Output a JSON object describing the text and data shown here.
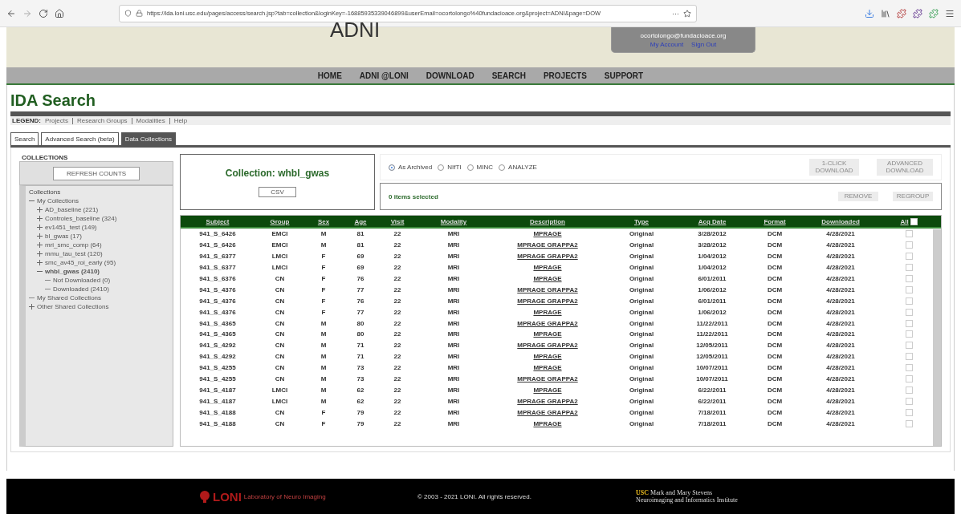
{
  "browser": {
    "url": "https://ida.loni.usc.edu/pages/access/search.jsp?tab=collection&loginKey=-16885935339046899&userEmail=ocortolongo%40fundacioace.org&project=ADNI&page=DOW",
    "more": "···"
  },
  "header": {
    "logo": "ADNI",
    "email": "ocortolongo@fundacioace.org",
    "links": [
      "My Account",
      "Sign Out"
    ]
  },
  "nav": [
    "HOME",
    "ADNI @LONI",
    "DOWNLOAD",
    "SEARCH",
    "PROJECTS",
    "SUPPORT"
  ],
  "page_title": "IDA Search",
  "legend": {
    "label": "LEGEND:",
    "links": [
      "Projects",
      "Research Groups",
      "Modalities",
      "Help"
    ]
  },
  "tabs": [
    {
      "label": "Search",
      "selected": false
    },
    {
      "label": "Advanced Search (beta)",
      "selected": false
    },
    {
      "label": "Data Collections",
      "selected": true
    }
  ],
  "collections": {
    "title": "COLLECTIONS",
    "refresh": "REFRESH COUNTS",
    "root": "Collections",
    "tree": [
      {
        "label": "My Collections",
        "expanded": true,
        "selected": false,
        "children": [
          {
            "label": "AD_baseline (221)",
            "expanded": false,
            "selected": false
          },
          {
            "label": "Controles_baseline (324)",
            "expanded": false,
            "selected": false
          },
          {
            "label": "ev1451_test (149)",
            "expanded": false,
            "selected": false
          },
          {
            "label": "bl_gwas (17)",
            "expanded": false,
            "selected": false
          },
          {
            "label": "mri_smc_comp (64)",
            "expanded": false,
            "selected": false
          },
          {
            "label": "mmu_tau_test (120)",
            "expanded": false,
            "selected": false
          },
          {
            "label": "smc_av45_roi_early (95)",
            "expanded": false,
            "selected": false
          },
          {
            "label": "whbl_gwas (2410)",
            "expanded": true,
            "selected": true,
            "children": [
              {
                "label": "Not Downloaded (0)",
                "selected": false
              },
              {
                "label": "Downloaded (2410)",
                "selected": false
              }
            ]
          }
        ]
      },
      {
        "label": "My Shared Collections",
        "selected": false
      },
      {
        "label": "Other Shared Collections",
        "expanded": false,
        "selected": false
      }
    ]
  },
  "collection": {
    "title": "Collection: whbl_gwas",
    "csv": "CSV"
  },
  "formats": [
    {
      "label": "As Archived",
      "selected": true
    },
    {
      "label": "NIfTI",
      "selected": false
    },
    {
      "label": "MINC",
      "selected": false
    },
    {
      "label": "ANALYZE",
      "selected": false
    }
  ],
  "download_buttons": [
    {
      "label": "1-CLICK DOWNLOAD",
      "disabled": true
    },
    {
      "label": "ADVANCED DOWNLOAD",
      "disabled": true
    }
  ],
  "selection": {
    "text": "0 items selected",
    "buttons": [
      {
        "label": "REMOVE",
        "disabled": true
      },
      {
        "label": "REGROUP",
        "disabled": true
      }
    ]
  },
  "table": {
    "columns": [
      "Subject",
      "Group",
      "Sex",
      "Age",
      "Visit",
      "Modality",
      "Description",
      "Type",
      "Acq Date",
      "Format",
      "Downloaded",
      "All"
    ],
    "all_checked": false,
    "rows": [
      [
        "941_S_6426",
        "EMCI",
        "M",
        "81",
        "22",
        "MRI",
        "MPRAGE",
        "Original",
        "3/28/2012",
        "DCM",
        "4/28/2021",
        false
      ],
      [
        "941_S_6426",
        "EMCI",
        "M",
        "81",
        "22",
        "MRI",
        "MPRAGE GRAPPA2",
        "Original",
        "3/28/2012",
        "DCM",
        "4/28/2021",
        false
      ],
      [
        "941_S_6377",
        "LMCI",
        "F",
        "69",
        "22",
        "MRI",
        "MPRAGE GRAPPA2",
        "Original",
        "1/04/2012",
        "DCM",
        "4/28/2021",
        false
      ],
      [
        "941_S_6377",
        "LMCI",
        "F",
        "69",
        "22",
        "MRI",
        "MPRAGE",
        "Original",
        "1/04/2012",
        "DCM",
        "4/28/2021",
        false
      ],
      [
        "941_S_6376",
        "CN",
        "F",
        "76",
        "22",
        "MRI",
        "MPRAGE",
        "Original",
        "6/01/2011",
        "DCM",
        "4/28/2021",
        false
      ],
      [
        "941_S_4376",
        "CN",
        "F",
        "77",
        "22",
        "MRI",
        "MPRAGE GRAPPA2",
        "Original",
        "1/06/2012",
        "DCM",
        "4/28/2021",
        false
      ],
      [
        "941_S_4376",
        "CN",
        "F",
        "76",
        "22",
        "MRI",
        "MPRAGE GRAPPA2",
        "Original",
        "6/01/2011",
        "DCM",
        "4/28/2021",
        false
      ],
      [
        "941_S_4376",
        "CN",
        "F",
        "77",
        "22",
        "MRI",
        "MPRAGE",
        "Original",
        "1/06/2012",
        "DCM",
        "4/28/2021",
        false
      ],
      [
        "941_S_4365",
        "CN",
        "M",
        "80",
        "22",
        "MRI",
        "MPRAGE GRAPPA2",
        "Original",
        "11/22/2011",
        "DCM",
        "4/28/2021",
        false
      ],
      [
        "941_S_4365",
        "CN",
        "M",
        "80",
        "22",
        "MRI",
        "MPRAGE",
        "Original",
        "11/22/2011",
        "DCM",
        "4/28/2021",
        false
      ],
      [
        "941_S_4292",
        "CN",
        "M",
        "71",
        "22",
        "MRI",
        "MPRAGE GRAPPA2",
        "Original",
        "12/05/2011",
        "DCM",
        "4/28/2021",
        false
      ],
      [
        "941_S_4292",
        "CN",
        "M",
        "71",
        "22",
        "MRI",
        "MPRAGE",
        "Original",
        "12/05/2011",
        "DCM",
        "4/28/2021",
        false
      ],
      [
        "941_S_4255",
        "CN",
        "M",
        "73",
        "22",
        "MRI",
        "MPRAGE",
        "Original",
        "10/07/2011",
        "DCM",
        "4/28/2021",
        false
      ],
      [
        "941_S_4255",
        "CN",
        "M",
        "73",
        "22",
        "MRI",
        "MPRAGE GRAPPA2",
        "Original",
        "10/07/2011",
        "DCM",
        "4/28/2021",
        false
      ],
      [
        "941_S_4187",
        "LMCI",
        "M",
        "62",
        "22",
        "MRI",
        "MPRAGE",
        "Original",
        "6/22/2011",
        "DCM",
        "4/28/2021",
        false
      ],
      [
        "941_S_4187",
        "LMCI",
        "M",
        "62",
        "22",
        "MRI",
        "MPRAGE GRAPPA2",
        "Original",
        "6/22/2011",
        "DCM",
        "4/28/2021",
        false
      ],
      [
        "941_S_4188",
        "CN",
        "F",
        "79",
        "22",
        "MRI",
        "MPRAGE GRAPPA2",
        "Original",
        "7/18/2011",
        "DCM",
        "4/28/2021",
        false
      ],
      [
        "941_S_4188",
        "CN",
        "F",
        "79",
        "22",
        "MRI",
        "MPRAGE",
        "Original",
        "7/18/2011",
        "DCM",
        "4/28/2021",
        false
      ]
    ]
  },
  "footer": {
    "logo": "LONI",
    "logo_sub": "Laboratory of Neuro Imaging",
    "copyright": "© 2003 - 2021 LONI. All rights reserved.",
    "inst_mark": "USC",
    "inst_line1": "Mark and Mary Stevens",
    "inst_line2": "Neuroimaging and Informatics Institute"
  }
}
